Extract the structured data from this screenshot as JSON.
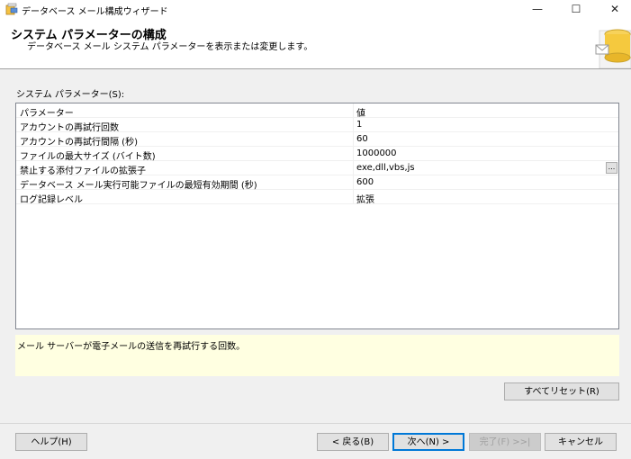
{
  "window": {
    "title": "データベース メール構成ウィザード",
    "minimize_glyph": "—",
    "maximize_glyph": "☐",
    "close_glyph": "✕"
  },
  "header": {
    "title": "システム パラメーターの構成",
    "subtitle": "データベース メール システム パラメーターを表示または変更します。"
  },
  "grid": {
    "label": "システム パラメーター(S):",
    "column_headers": [
      "パラメーター",
      "値"
    ],
    "rows": [
      {
        "name": "アカウントの再試行回数",
        "value": "1"
      },
      {
        "name": "アカウントの再試行間隔 (秒)",
        "value": "60"
      },
      {
        "name": "ファイルの最大サイズ (バイト数)",
        "value": "1000000"
      },
      {
        "name": "禁止する添付ファイルの拡張子",
        "value": "exe,dll,vbs,js",
        "ellipsis": "..."
      },
      {
        "name": "データベース メール実行可能ファイルの最短有効期間 (秒)",
        "value": "600"
      },
      {
        "name": "ログ記録レベル",
        "value": "拡張"
      }
    ]
  },
  "description": "メール サーバーが電子メールの送信を再試行する回数。",
  "buttons": {
    "reset_all": "すべてリセット(R)",
    "help": "ヘルプ(H)",
    "back": "< 戻る(B)",
    "next": "次へ(N) >",
    "finish": "完了(F) >>|",
    "cancel": "キャンセル"
  },
  "colors": {
    "accent": "#0078d7",
    "description_bg": "#ffffe1",
    "window_bg": "#f0f0f0"
  }
}
